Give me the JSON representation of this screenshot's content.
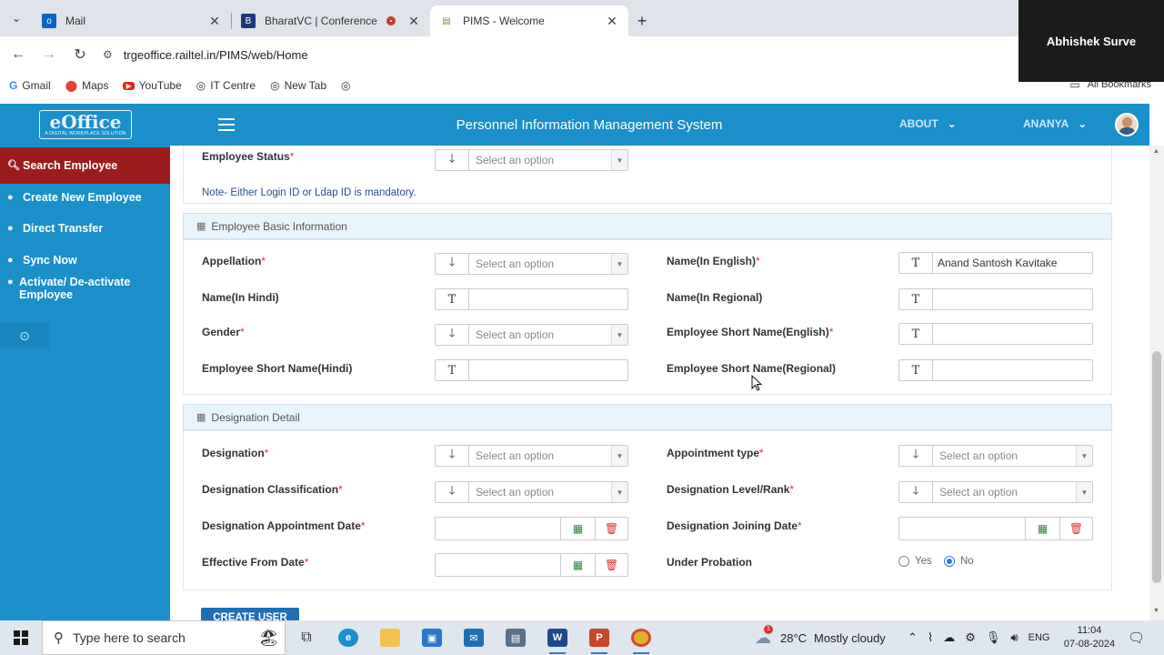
{
  "browser": {
    "tabs": [
      {
        "title": "Mail",
        "icon": "outlook-icon",
        "active": false
      },
      {
        "title": "BharatVC | Conference",
        "icon": "bharatvc-icon",
        "active": false,
        "recording": true
      },
      {
        "title": "PIMS - Welcome",
        "icon": "page-icon",
        "active": true
      }
    ],
    "url": "trgeoffice.railtel.in/PIMS/web/Home",
    "bookmarks": [
      {
        "label": "Gmail",
        "icon": "google-icon"
      },
      {
        "label": "Maps",
        "icon": "maps-icon"
      },
      {
        "label": "YouTube",
        "icon": "youtube-icon"
      },
      {
        "label": "IT Centre",
        "icon": "globe-icon"
      },
      {
        "label": "New Tab",
        "icon": "globe-icon"
      }
    ],
    "all_bookmarks": "All Bookmarks"
  },
  "participant_overlay": "Abhishek Surve",
  "header": {
    "logo_main": "eOffice",
    "logo_sub": "A DIGITAL WORKPLACE SOLUTION",
    "title": "Personnel Information Management System",
    "about": "ABOUT",
    "user": "ANANYA"
  },
  "sidebar": {
    "items": [
      {
        "label": "Search Employee",
        "icon": "search-icon",
        "active": true
      },
      {
        "label": "Create New Employee",
        "icon": "user-icon"
      },
      {
        "label": "Direct Transfer",
        "icon": "user-icon"
      },
      {
        "label": "Sync Now",
        "icon": "user-icon"
      },
      {
        "label": "Activate/ De-activate Employee",
        "icon": "user-icon"
      }
    ]
  },
  "form": {
    "employee_status_label": "Employee Status",
    "select_placeholder": "Select an option",
    "note": "Note- Either Login ID or Ldap ID is mandatory.",
    "basic_section": "Employee Basic Information",
    "appellation_label": "Appellation",
    "name_english_label": "Name(In English)",
    "name_english_value": "Anand Santosh Kavitake",
    "name_hindi_label": "Name(In Hindi)",
    "name_regional_label": "Name(In Regional)",
    "gender_label": "Gender",
    "short_name_english_label": "Employee Short Name(English)",
    "short_name_hindi_label": "Employee Short Name(Hindi)",
    "short_name_regional_label": "Employee Short Name(Regional)",
    "designation_section": "Designation Detail",
    "designation_label": "Designation",
    "appointment_type_label": "Appointment type",
    "designation_classification_label": "Designation Classification",
    "designation_level_label": "Designation Level/Rank",
    "designation_appointment_date_label": "Designation Appointment Date",
    "designation_joining_date_label": "Designation Joining Date",
    "effective_from_label": "Effective From Date",
    "under_probation_label": "Under Probation",
    "probation_yes": "Yes",
    "probation_no": "No",
    "probation_selected": "No",
    "required_mark": "*",
    "create_button": "CREATE USER"
  },
  "taskbar": {
    "search_placeholder": "Type here to search",
    "weather_temp": "28°C",
    "weather_text": "Mostly cloudy",
    "weather_badge": "1",
    "language": "ENG",
    "time": "11:04",
    "date": "07-08-2024"
  }
}
